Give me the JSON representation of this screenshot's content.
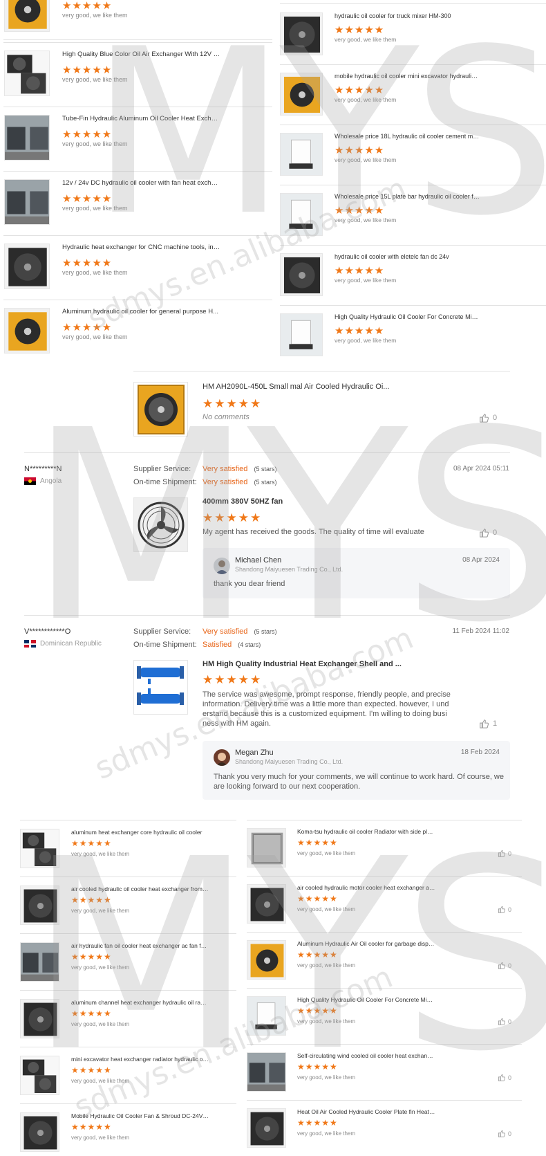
{
  "top_left_products": [
    {
      "title": "",
      "comment": "very good, we like them"
    },
    {
      "title": "High Quality Blue Color Oil Air Exchanger With 12V Wi...",
      "comment": "very good, we like them"
    },
    {
      "title": "Tube-Fin Hydraulic Aluminum Oil Cooler Heat Exchan...",
      "comment": "very good, we like them"
    },
    {
      "title": "12v / 24v DC hydraulic oil cooler with fan heat exchan...",
      "comment": "very good, we like them"
    },
    {
      "title": "Hydraulic heat exchanger for CNC machine tools, ind...",
      "comment": "very good, we like them"
    },
    {
      "title": "Aluminum hydraulic oil cooler for general purpose H...",
      "comment": "very good, we like them"
    }
  ],
  "top_right_products": [
    {
      "title": "hydraulic oil cooler for truck mixer HM-300",
      "comment": "very good, we like them"
    },
    {
      "title": "mobile hydraulic oil cooler mini excavator hydraulic oi...",
      "comment": "very good, we like them"
    },
    {
      "title": "Wholesale price 18L hydraulic oil cooler cement mixe...",
      "comment": "very good, we like them"
    },
    {
      "title": "Wholesale price 15L plate bar hydraulic oil cooler for ...",
      "comment": "very good, we like them"
    },
    {
      "title": "hydraulic oil cooler with eletelc fan dc 24v",
      "comment": "very good, we like them"
    },
    {
      "title": "High Quality Hydraulic Oil Cooler For Concrete Mixer ...",
      "comment": "very good, we like them"
    }
  ],
  "stars_glyph": "★★★★★",
  "single_review": {
    "title": "HM AH2090L-450L Small mal Air Cooled Hydraulic Oi...",
    "comment": "No comments",
    "likes": "0"
  },
  "labels": {
    "supplier_service": "Supplier Service:",
    "on_time_shipment": "On-time Shipment:"
  },
  "reviews": [
    {
      "user": "N*********N",
      "country": "Angola",
      "supplier_rating": "Very satisfied",
      "supplier_stars": "(5 stars)",
      "shipment_rating": "Very satisfied",
      "shipment_stars": "(5 stars)",
      "date": "08 Apr 2024 05:11",
      "product": "400mm 380V 50HZ fan",
      "text": "My agent has received the goods. The quality of time will evaluate",
      "likes": "0",
      "reply": {
        "name": "Michael Chen",
        "company": "Shandong Maiyuesen Trading Co., Ltd.",
        "date": "08 Apr 2024",
        "text": "thank you dear friend"
      }
    },
    {
      "user": "V************O",
      "country": "Dominican Republic",
      "supplier_rating": "Very satisfied",
      "supplier_stars": "(5 stars)",
      "shipment_rating": "Satisfied",
      "shipment_stars": "(4 stars)",
      "date": "11 Feb 2024 11:02",
      "product": "HM High Quality Industrial Heat Exchanger Shell and ...",
      "text_lines": [
        "The service was awesome, prompt response, friendly people, and precise",
        "information. Delivery time was a little more than expected. however, I und",
        "erstand because this is a customized equipment. I'm willing to doing busi",
        "ness with HM again."
      ],
      "likes": "1",
      "reply": {
        "name": "Megan Zhu",
        "company": "Shandong Maiyuesen Trading Co., Ltd.",
        "date": "18 Feb 2024",
        "text_lines": [
          "Thank you very much for your comments, we will continue to work hard. Of course, we",
          "are looking forward to our next cooperation."
        ]
      }
    }
  ],
  "bottom_left_products": [
    {
      "title": "aluminum heat exchanger core hydraulic oil cooler",
      "comment": "very good, we like them"
    },
    {
      "title": "air cooled hydraulic oil cooler heat exchanger from ch...",
      "comment": "very good, we like them"
    },
    {
      "title": "air hydraulic fan oil cooler heat exchanger ac fan for h...",
      "comment": "very good, we like them"
    },
    {
      "title": "aluminum channel heat exchanger hydraulic oil radiator",
      "comment": "very good, we like them"
    },
    {
      "title": "mini excavator heat exchanger radiator hydraulic oil c...",
      "comment": "very good, we like them"
    },
    {
      "title": "Mobile Hydraulic Oil Cooler Fan & Shroud DC-24V 100...",
      "comment": "very good, we like them"
    }
  ],
  "bottom_right_products": [
    {
      "title": "Koma-tsu hydraulic oil cooler Radiator with side plate ...",
      "comment": "very good, we like them",
      "likes": "0"
    },
    {
      "title": "air cooled hydraulic motor cooler heat exchanger air c...",
      "comment": "very good, we like them",
      "likes": "0"
    },
    {
      "title": "Aluminum Hydraulic Air Oil cooler for garbage dispos...",
      "comment": "very good, we like them",
      "likes": "0"
    },
    {
      "title": "High Quality Hydraulic Oil Cooler For Concrete Mixer ...",
      "comment": "very good, we like them",
      "likes": "0"
    },
    {
      "title": "Self-circulating wind cooled oil cooler heat exchanger...",
      "comment": "very good, we like them",
      "likes": "0"
    },
    {
      "title": "Heat Oil Air Cooled Hydraulic Cooler Plate fin Heat Ex...",
      "comment": "very good, we like them",
      "likes": "0"
    }
  ],
  "watermark": {
    "letters": "MYS",
    "domain": "sdmys.en.alibaba.com"
  },
  "colors": {
    "star": "#f07818",
    "rating_orange": "#e8661a",
    "reply_bg": "#f5f6f8",
    "divider": "#e2e2e2"
  }
}
